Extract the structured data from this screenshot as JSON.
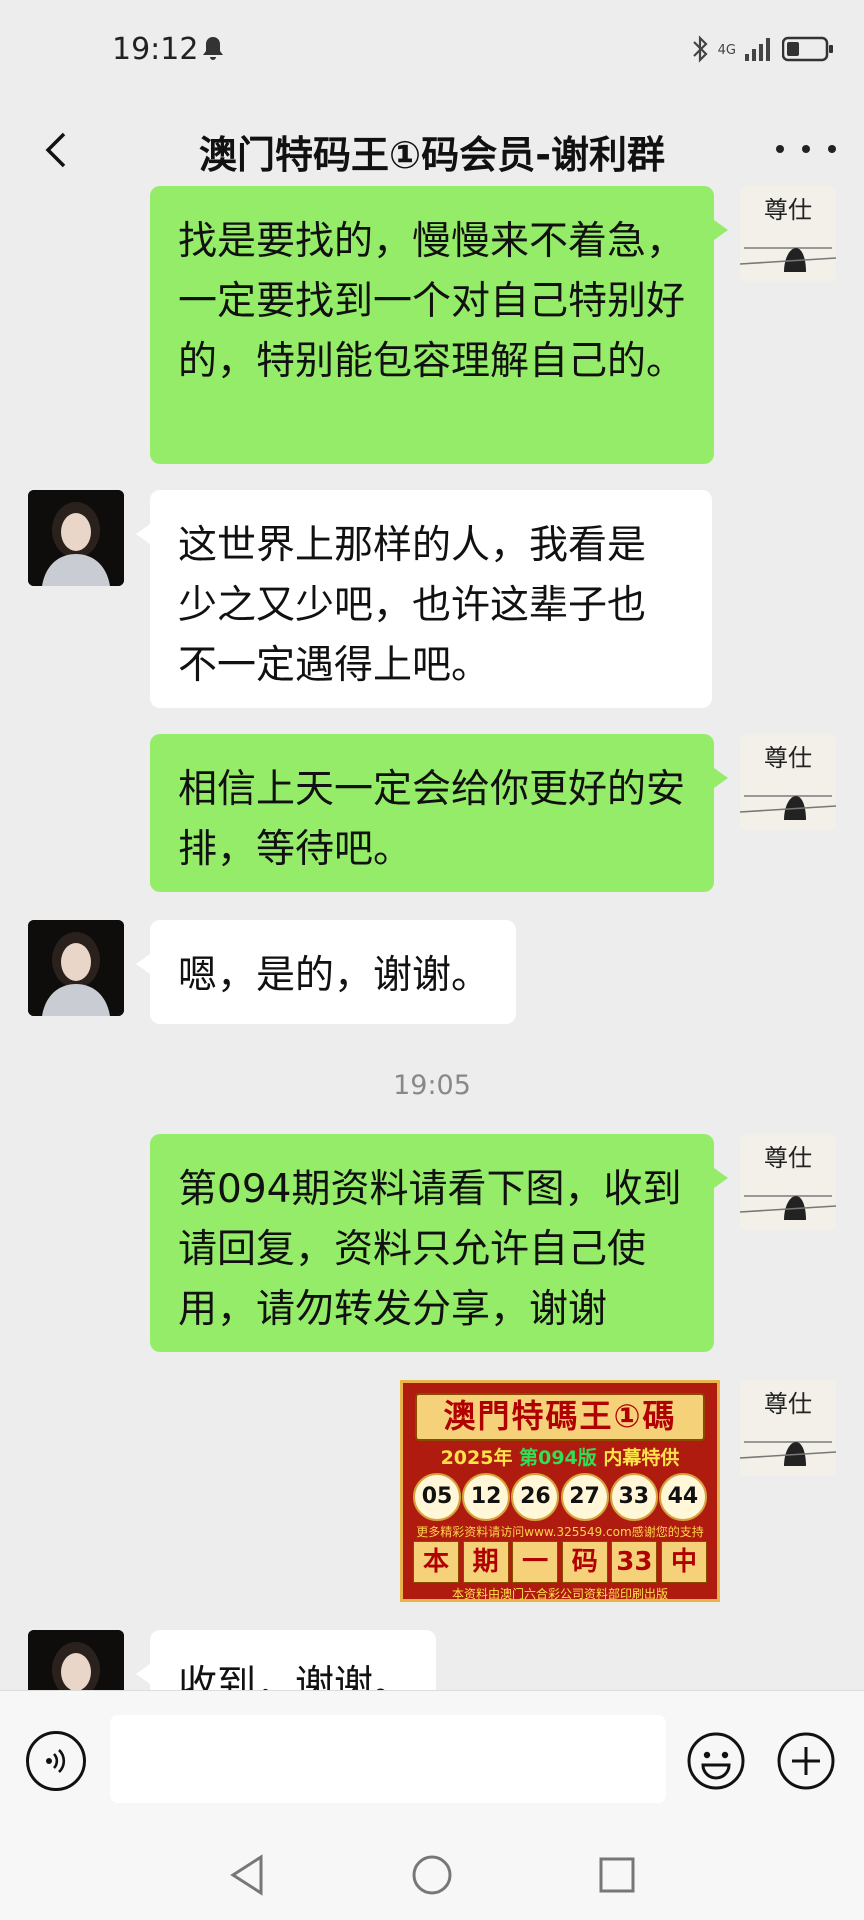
{
  "status": {
    "time": "19:12",
    "network": "4G"
  },
  "header": {
    "title": "澳门特码王①码会员-谢利群"
  },
  "messages": [
    {
      "side": "me",
      "text": "找是要找的，慢慢来不着急，一定要找到一个对自己特别好的，特别能包容理解自己的。"
    },
    {
      "side": "other",
      "text": "这世界上那样的人，我看是少之又少吧，也许这辈子也不一定遇得上吧。"
    },
    {
      "side": "me",
      "text": "相信上天一定会给你更好的安排，等待吧。"
    },
    {
      "side": "other",
      "text": "嗯，是的，谢谢。"
    },
    {
      "side": "me",
      "text": "第094期资料请看下图，收到请回复，资料只允许自己使用，请勿转发分享，谢谢"
    },
    {
      "side": "other",
      "text": "收到，谢谢。"
    }
  ],
  "timestamp": "19:05",
  "promo_image": {
    "title": "澳門特碼王①碼",
    "year": "2025年",
    "issue": "第094版",
    "tag": "内幕特供",
    "numbers": [
      "05",
      "12",
      "26",
      "27",
      "33",
      "44"
    ],
    "url_line": "更多精彩资料请访问www.325549.com感谢您的支持",
    "bottom_chars": [
      "本",
      "期",
      "一",
      "码",
      "33",
      "中"
    ],
    "footer": "本资料由澳门六合彩公司资料部印刷出版"
  },
  "colors": {
    "self_bubble": "#95ec69",
    "other_bubble": "#ffffff",
    "background": "#ededed"
  }
}
